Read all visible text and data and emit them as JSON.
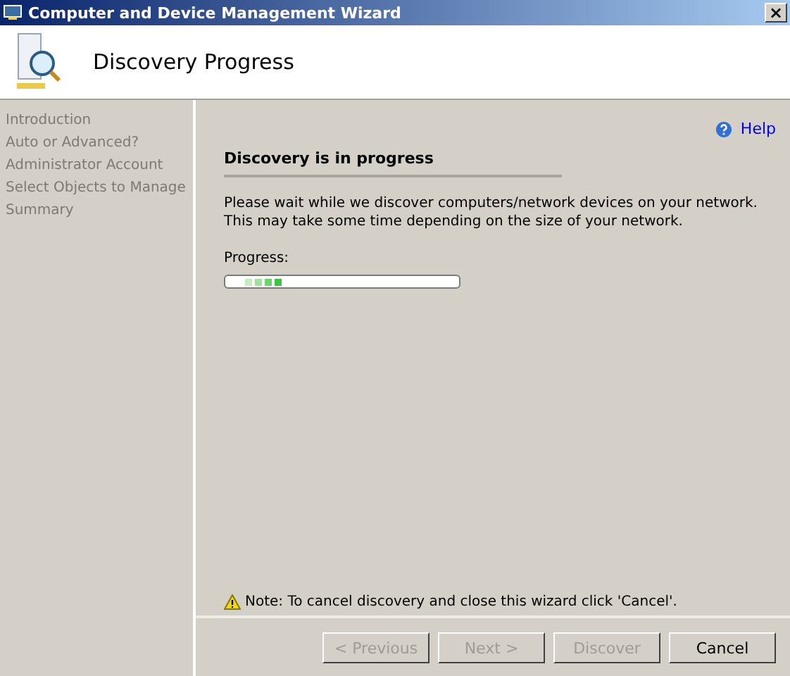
{
  "window": {
    "title": "Computer and Device Management Wizard",
    "close": "×"
  },
  "header": {
    "title": "Discovery Progress"
  },
  "sidebar": {
    "items": [
      {
        "label": "Introduction"
      },
      {
        "label": "Auto or Advanced?"
      },
      {
        "label": "Administrator Account"
      },
      {
        "label": "Select Objects to Manage"
      },
      {
        "label": "Summary"
      }
    ]
  },
  "help": {
    "label": "Help"
  },
  "section": {
    "title": "Discovery is in progress",
    "description": "Please wait while we discover computers/network devices on your network.  This may take some time depending on the size of your network.",
    "progress_label": "Progress:",
    "progress_indeterminate": true
  },
  "note": "Note: To cancel discovery and close this wizard click 'Cancel'.",
  "buttons": [
    {
      "label": "< Previous",
      "disabled": true
    },
    {
      "label": "Next >",
      "disabled": true
    },
    {
      "label": "Discover",
      "disabled": true
    },
    {
      "label": "Cancel",
      "disabled": false
    }
  ]
}
